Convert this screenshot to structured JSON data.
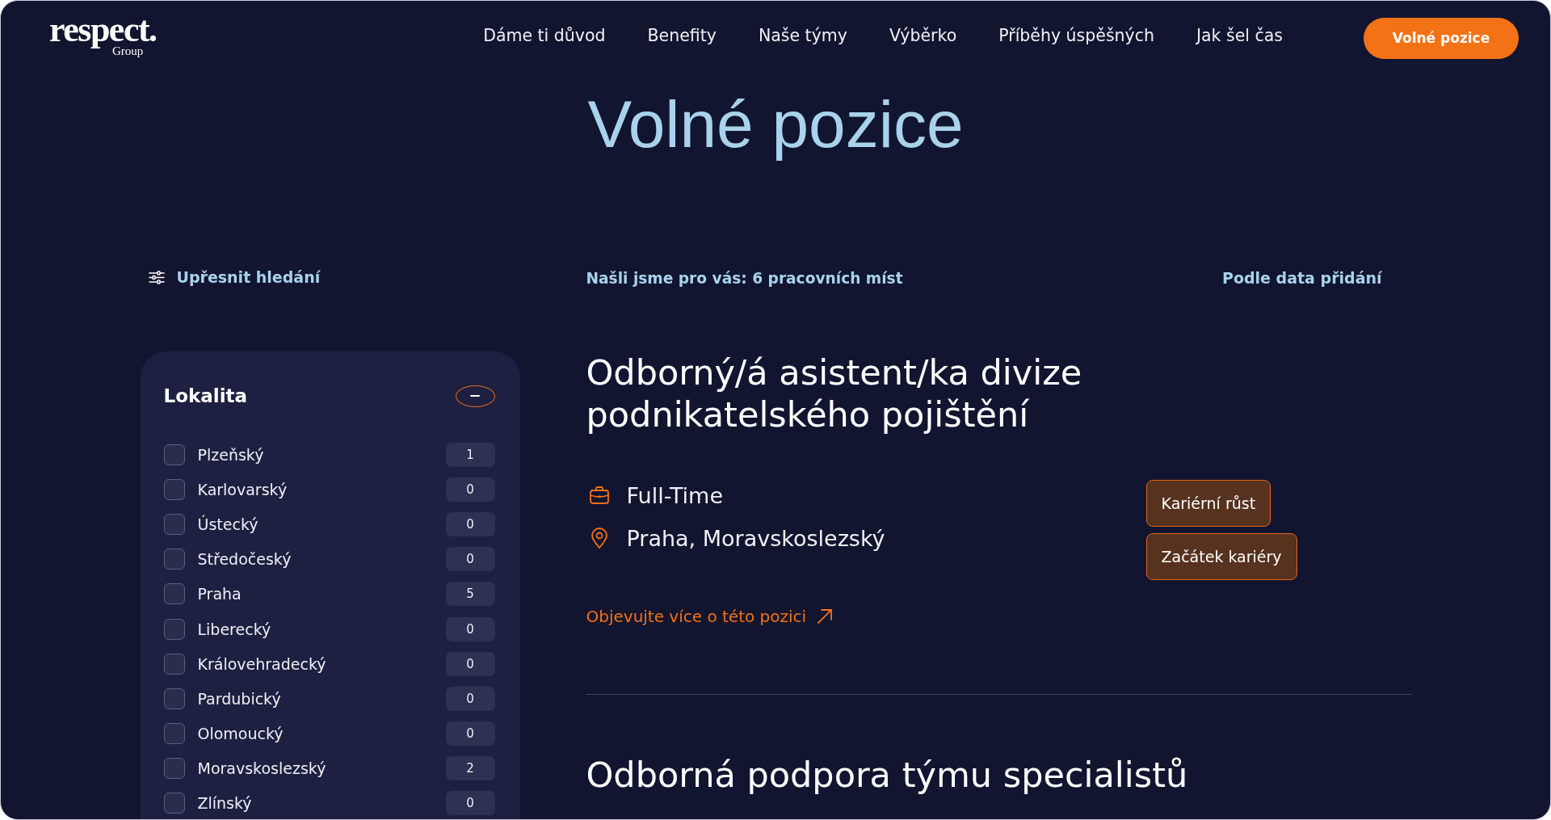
{
  "header": {
    "logo": {
      "wordmark": "respect.",
      "subtitle": "Group"
    },
    "nav": [
      "Dáme ti důvod",
      "Benefity",
      "Naše týmy",
      "Výběrko",
      "Příběhy úspěšných",
      "Jak šel čas"
    ],
    "cta": "Volné pozice"
  },
  "page_title": "Volné pozice",
  "toolbar": {
    "refine": "Upřesnit hledání",
    "results": "Našli jsme pro vás: **6 pracovních míst**",
    "sort": "Podle data přidání"
  },
  "filter": {
    "title": "Lokalita",
    "expanded": true,
    "options": [
      {
        "label": "Plzeňský",
        "count": "1",
        "checked": false
      },
      {
        "label": "Karlovarský",
        "count": "0",
        "checked": false
      },
      {
        "label": "Ústecký",
        "count": "0",
        "checked": false
      },
      {
        "label": "Středočeský",
        "count": "0",
        "checked": false
      },
      {
        "label": "Praha",
        "count": "5",
        "checked": false
      },
      {
        "label": "Liberecký",
        "count": "0",
        "checked": false
      },
      {
        "label": "Královehradecký",
        "count": "0",
        "checked": false
      },
      {
        "label": "Pardubický",
        "count": "0",
        "checked": false
      },
      {
        "label": "Olomoucký",
        "count": "0",
        "checked": false
      },
      {
        "label": "Moravskoslezský",
        "count": "2",
        "checked": false
      },
      {
        "label": "Zlínský",
        "count": "0",
        "checked": false
      }
    ]
  },
  "jobs": [
    {
      "title": "Odborný/á asistent/ka divize podnikatelského pojištění",
      "details": [
        {
          "kind": "employment",
          "text": "Full-Time"
        },
        {
          "kind": "location",
          "text": "Praha, Moravskoslezský"
        }
      ],
      "tags": [
        "Kariérní růst",
        "Začátek kariéry"
      ],
      "link": "Objevujte více o této pozici"
    },
    {
      "title": "Odborná podpora týmu specialistů"
    }
  ]
}
